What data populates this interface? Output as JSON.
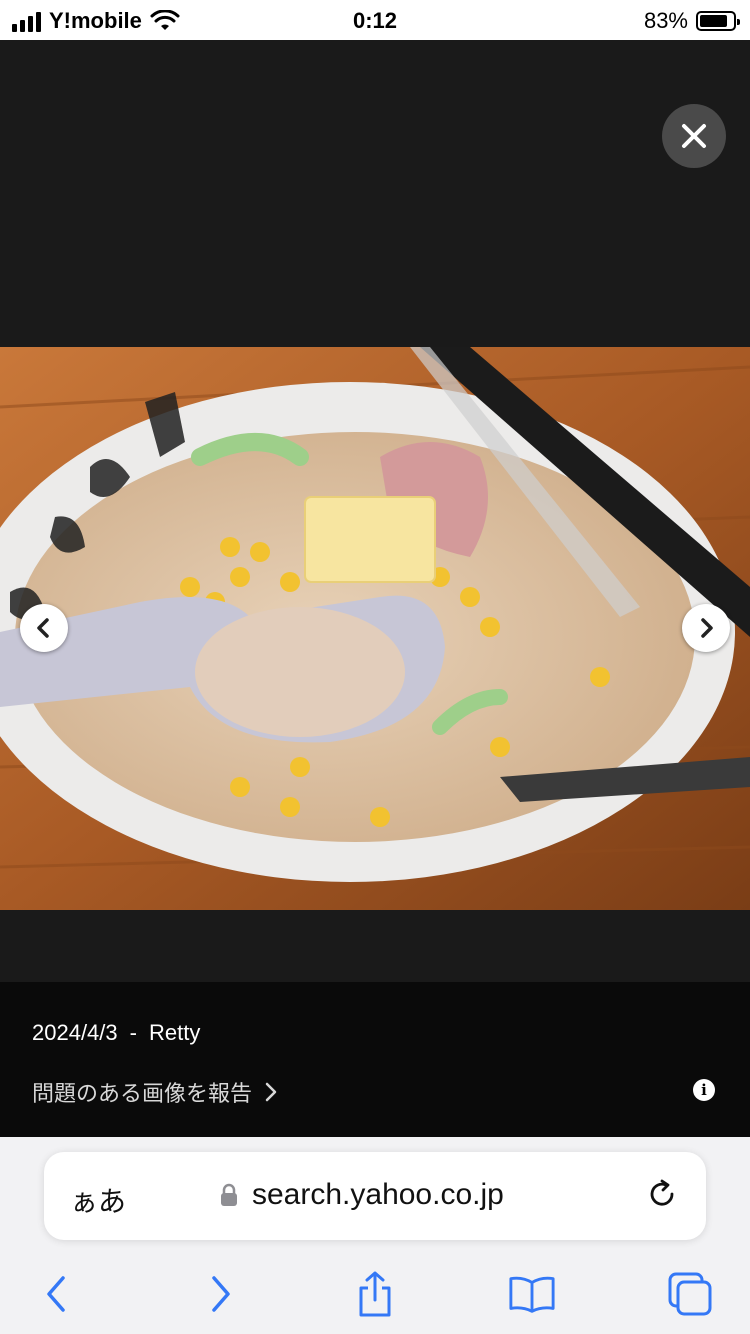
{
  "status": {
    "carrier": "Y!mobile",
    "time": "0:12",
    "battery": "83%",
    "battery_level": 0.83
  },
  "viewer": {
    "image": {
      "subject": "ramen-bowl-photo"
    }
  },
  "info": {
    "date": "2024/4/3",
    "separator": "-",
    "source": "Retty",
    "report_link": "問題のある画像を報告"
  },
  "browser": {
    "text_size_button": "ぁあ",
    "url": "search.yahoo.co.jp"
  },
  "icons": {
    "close": "close-icon",
    "prev": "chevron-left-icon",
    "next": "chevron-right-icon",
    "info": "info-icon",
    "lock": "lock-icon",
    "reload": "reload-icon",
    "back": "back-icon",
    "forward": "forward-icon",
    "share": "share-icon",
    "bookmarks": "bookmarks-icon",
    "tabs": "tabs-icon"
  },
  "colors": {
    "accent": "#3478f6",
    "viewer_bg": "#1a1a1a",
    "info_bg": "#0a0a0a"
  }
}
